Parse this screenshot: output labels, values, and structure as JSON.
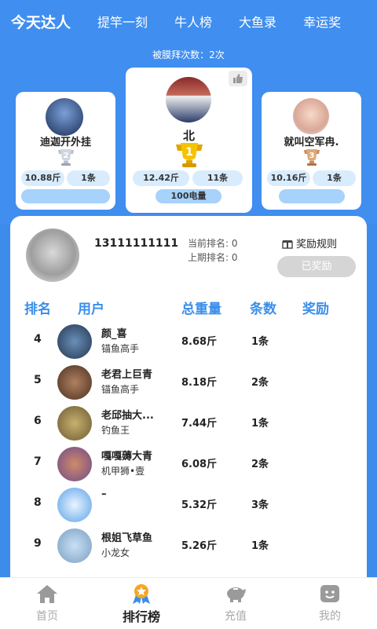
{
  "tabs": [
    "今天达人",
    "提竿一刻",
    "牛人榜",
    "大鱼录",
    "幸运奖"
  ],
  "worship_text": "被膜拜次数：2次",
  "podium": {
    "first": {
      "name": "北",
      "weight": "12.42斤",
      "count": "11条",
      "power": "100电量",
      "medal": "1"
    },
    "second": {
      "name": "迪迦开外挂",
      "weight": "10.88斤",
      "count": "1条",
      "medal": "2"
    },
    "third": {
      "name": "就叫空军冉.",
      "weight": "10.16斤",
      "count": "1条",
      "medal": "3"
    }
  },
  "me": {
    "phone": "13111111111",
    "current_rank": "当前排名: 0",
    "last_rank": "上期排名: 0",
    "rules_label": "奖励规则",
    "claimed_label": "已奖励"
  },
  "table_headers": {
    "rank": "排名",
    "user": "用户",
    "weight": "总重量",
    "count": "条数",
    "reward": "奖励"
  },
  "rows": [
    {
      "rank": "4",
      "name": "颜_喜",
      "title": "锚鱼高手",
      "weight": "8.68斤",
      "count": "1条"
    },
    {
      "rank": "5",
      "name": "老君上巨青",
      "title": "锚鱼高手",
      "weight": "8.18斤",
      "count": "2条"
    },
    {
      "rank": "6",
      "name": "老邱抽大...",
      "title": "钓鱼王",
      "weight": "7.44斤",
      "count": "1条"
    },
    {
      "rank": "7",
      "name": "嘎嘎薅大青",
      "title": "机甲狮•壹",
      "weight": "6.08斤",
      "count": "2条"
    },
    {
      "rank": "8",
      "name": "–",
      "title": "",
      "weight": "5.32斤",
      "count": "3条"
    },
    {
      "rank": "9",
      "name": "根姐飞草鱼",
      "title": "小龙女",
      "weight": "5.26斤",
      "count": "1条"
    }
  ],
  "nav": [
    {
      "label": "首页",
      "icon": "home-icon"
    },
    {
      "label": "排行榜",
      "icon": "ranking-icon"
    },
    {
      "label": "充值",
      "icon": "piggy-bank-icon"
    },
    {
      "label": "我的",
      "icon": "profile-icon"
    }
  ],
  "colors": {
    "accent": "#3f8ef0",
    "gold": "#f0b400",
    "pill": "#d8ecfd"
  }
}
